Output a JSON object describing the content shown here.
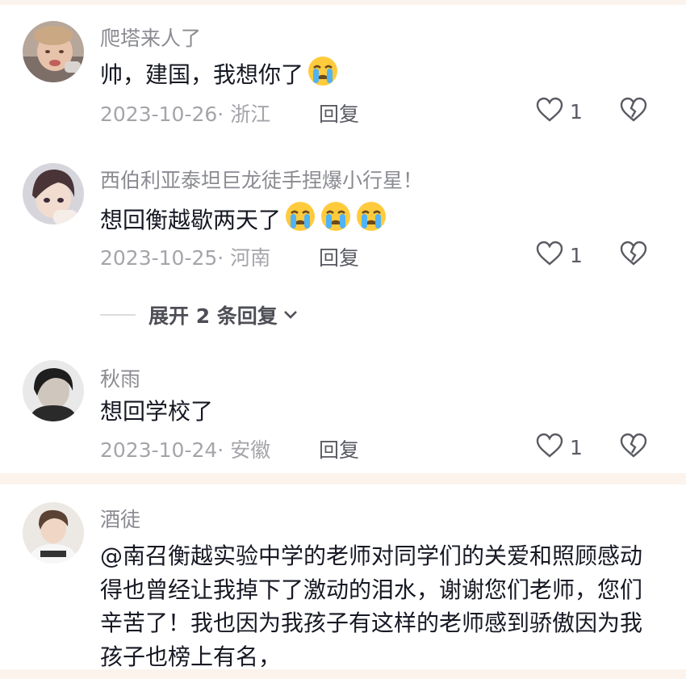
{
  "comments": [
    {
      "username": "爬塔来人了",
      "text": "帅，建国，我想你了",
      "emoji_count": 1,
      "date": "2023-10-26",
      "location": "· 浙江",
      "reply_label": "回复",
      "likes": "1"
    },
    {
      "username": "西伯利亚泰坦巨龙徒手捏爆小行星！",
      "text": "想回衡越歇两天了",
      "emoji_count": 3,
      "date": "2023-10-25",
      "location": "· 河南",
      "reply_label": "回复",
      "likes": "1"
    },
    {
      "username": "秋雨",
      "text": "想回学校了",
      "emoji_count": 0,
      "date": "2023-10-24",
      "location": "· 安徽",
      "reply_label": "回复",
      "likes": "1"
    },
    {
      "username": "酒徒",
      "text": "@南召衡越实验中学的老师对同学们的关爱和照顾感动得也曾经让我掉下了激动的泪水，谢谢您们老师，您们辛苦了！我也因为我孩子有这样的老师感到骄傲因为我孩子也榜上有名，"
    }
  ],
  "expand_replies": "展开 2 条回复",
  "icons": {
    "like": "heart-outline-icon",
    "dislike": "broken-heart-icon",
    "emoji": "crying-face-emoji",
    "expand": "chevron-down-icon"
  },
  "colors": {
    "username": "#8a8b91",
    "meta": "#a4a5aa",
    "text": "#161823",
    "separator_band": "#fbf3ec"
  }
}
